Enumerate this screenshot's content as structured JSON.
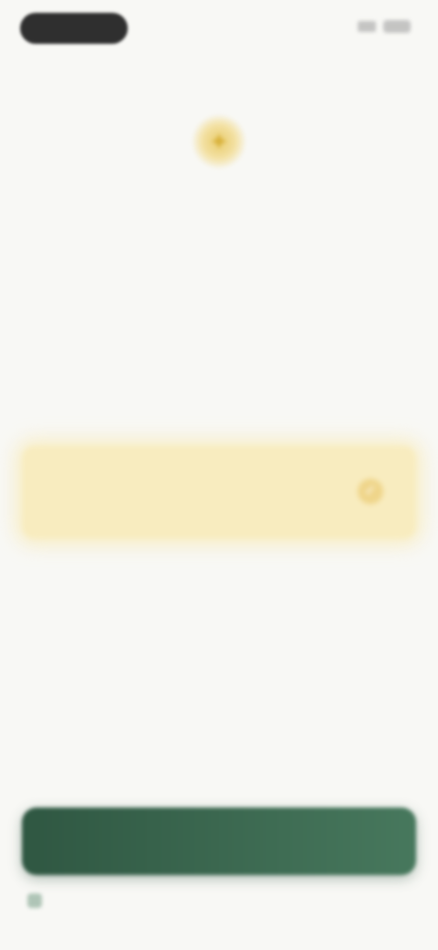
{
  "status_bar": {
    "time": "",
    "icons": [
      "signal-icon",
      "battery-icon"
    ]
  },
  "header": {
    "eyebrow": "",
    "badge_icon": "sparkle-icon",
    "title": ""
  },
  "options": [
    {
      "label": "",
      "selected": false
    },
    {
      "label": "",
      "selected": false
    },
    {
      "label": "",
      "selected": true
    },
    {
      "label": "",
      "selected": false
    },
    {
      "label": "",
      "selected": false
    }
  ],
  "cta": {
    "label": ""
  },
  "footer": {
    "note": ""
  },
  "colors": {
    "background": "#f8f8f5",
    "selected_option": "#f8ecbf",
    "accent_gold": "#e9cc6c",
    "cta_green": "#3b6a50"
  }
}
